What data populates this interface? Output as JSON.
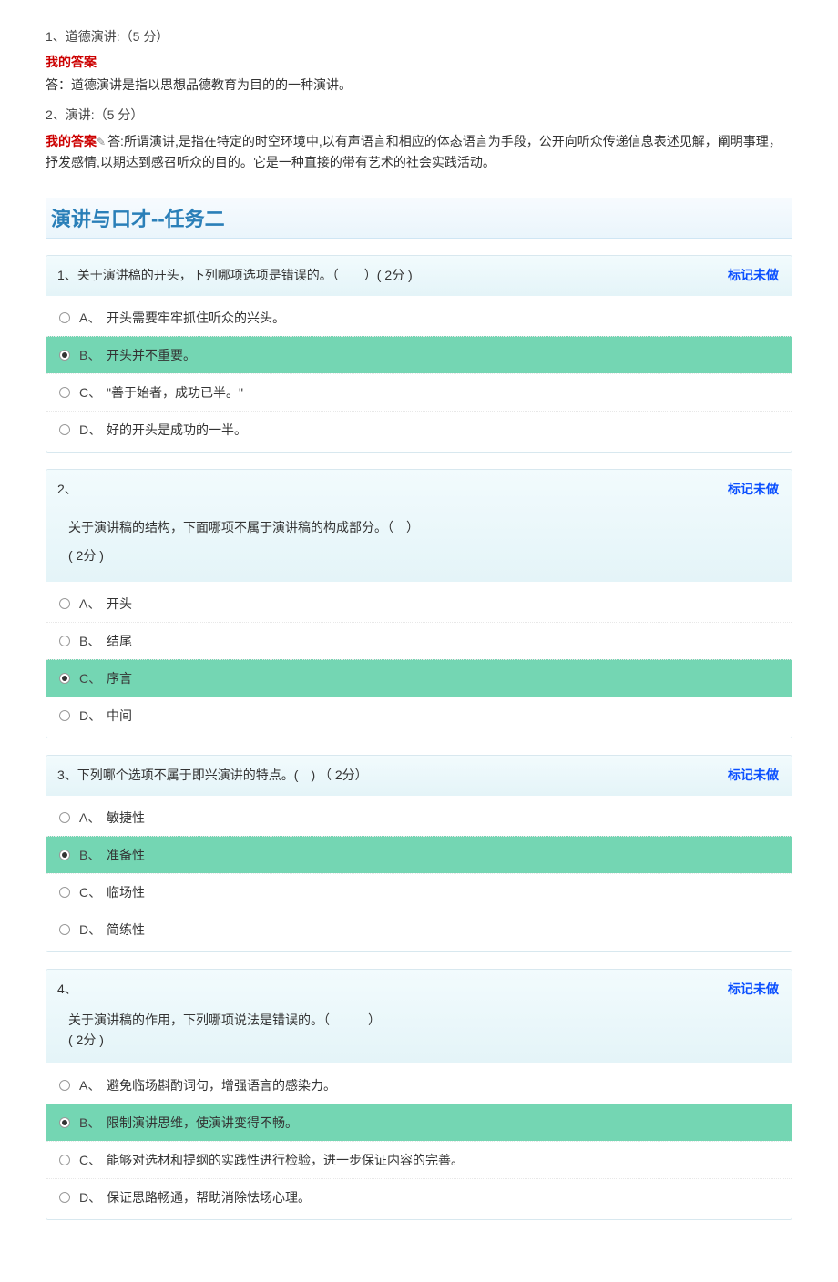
{
  "essay": {
    "q1": {
      "num": "1、道德演讲:（5 分）",
      "myAnswerLabel": "我的答案",
      "ans": "答：道德演讲是指以思想品德教育为目的的一种演讲。"
    },
    "q2": {
      "num": "2、演讲:（5 分）",
      "myAnswerLabel": "我的答案",
      "pencil": "✎",
      "ans": "答:所谓演讲,是指在特定的时空环境中,以有声语言和相应的体态语言为手段，公开向听众传递信息表述见解，阐明事理，抒发感情,以期达到感召听众的目的。它是一种直接的带有艺术的社会实践活动。"
    }
  },
  "sectionTitle": "演讲与口才--任务二",
  "markLabel": "标记未做",
  "questions": [
    {
      "num": "1、",
      "stem": "关于演讲稿的开头，下列哪项选项是错误的。（　　）( 2分 )",
      "opts": [
        {
          "letter": "A、",
          "text": "开头需要牢牢抓住听众的兴头。",
          "sel": false
        },
        {
          "letter": "B、",
          "text": "开头并不重要。",
          "sel": true
        },
        {
          "letter": "C、",
          "text": "\"善于始者，成功已半。\"",
          "sel": false
        },
        {
          "letter": "D、",
          "text": "好的开头是成功的一半。",
          "sel": false
        }
      ]
    },
    {
      "num": "2、",
      "stemLines": [
        "关于演讲稿的结构，下面哪项不属于演讲稿的构成部分。（　）",
        "( 2分 )"
      ],
      "opts": [
        {
          "letter": "A、",
          "text": "开头",
          "sel": false
        },
        {
          "letter": "B、",
          "text": "结尾",
          "sel": false
        },
        {
          "letter": "C、",
          "text": "序言",
          "sel": true
        },
        {
          "letter": "D、",
          "text": "中间",
          "sel": false
        }
      ]
    },
    {
      "num": "3、",
      "stem": "下列哪个选项不属于即兴演讲的特点。(　) （ 2分）",
      "opts": [
        {
          "letter": "A、",
          "text": "敏捷性",
          "sel": false
        },
        {
          "letter": "B、",
          "text": "准备性",
          "sel": true
        },
        {
          "letter": "C、",
          "text": "临场性",
          "sel": false
        },
        {
          "letter": "D、",
          "text": "简练性",
          "sel": false
        }
      ]
    },
    {
      "num": "4、",
      "stemLines": [
        "关于演讲稿的作用，下列哪项说法是错误的。（　　　）",
        "( 2分 )"
      ],
      "opts": [
        {
          "letter": "A、",
          "text": "避免临场斟酌词句，增强语言的感染力。",
          "sel": false
        },
        {
          "letter": "B、",
          "text": "限制演讲思维，使演讲变得不畅。",
          "sel": true
        },
        {
          "letter": "C、",
          "text": "能够对选材和提纲的实践性进行检验，进一步保证内容的完善。",
          "sel": false
        },
        {
          "letter": "D、",
          "text": "保证思路畅通，帮助消除怯场心理。",
          "sel": false
        }
      ]
    }
  ]
}
